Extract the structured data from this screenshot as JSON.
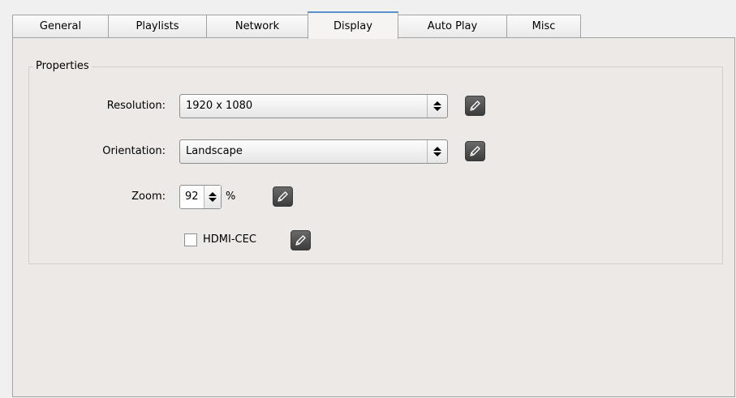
{
  "tabs": [
    {
      "label": "General",
      "active": false
    },
    {
      "label": "Playlists",
      "active": false
    },
    {
      "label": "Network",
      "active": false
    },
    {
      "label": "Display",
      "active": true
    },
    {
      "label": "Auto Play",
      "active": false
    },
    {
      "label": "Misc",
      "active": false
    }
  ],
  "properties": {
    "title": "Properties",
    "resolution": {
      "label": "Resolution:",
      "value": "1920 x 1080"
    },
    "orientation": {
      "label": "Orientation:",
      "value": "Landscape"
    },
    "zoom": {
      "label": "Zoom:",
      "value": "92",
      "unit": "%"
    },
    "hdmi_cec": {
      "label": "HDMI-CEC",
      "checked": false
    }
  },
  "icons": {
    "edit": "pencil-icon",
    "spin": "up-down-arrows-icon"
  },
  "colors": {
    "active_tab_accent": "#5b8fc9",
    "edit_button": "#4a4a4a",
    "panel_bg": "#ece9e6"
  }
}
